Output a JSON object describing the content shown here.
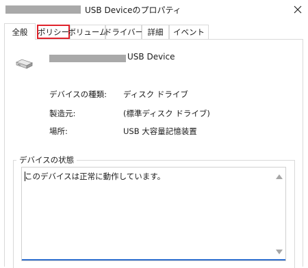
{
  "window": {
    "title": "USB Deviceのプロパティ"
  },
  "tabs": [
    {
      "label": "全般"
    },
    {
      "label": "ポリシー"
    },
    {
      "label": "ボリューム"
    },
    {
      "label": "ドライバー"
    },
    {
      "label": "詳細"
    },
    {
      "label": "イベント"
    }
  ],
  "device": {
    "name": "USB Device",
    "icon": "drive-icon"
  },
  "properties": [
    {
      "label": "デバイスの種類:",
      "value": "ディスク ドライブ"
    },
    {
      "label": "製造元:",
      "value": "(標準ディスク ドライブ)"
    },
    {
      "label": "場所:",
      "value": "USB 大容量記憶装置"
    }
  ],
  "status": {
    "legend": "デバイスの状態",
    "text": "このデバイスは正常に動作しています。"
  },
  "colors": {
    "highlight": "#e0212a",
    "focus_underline": "#2f6fcf",
    "redaction": "#a9a9a9"
  }
}
